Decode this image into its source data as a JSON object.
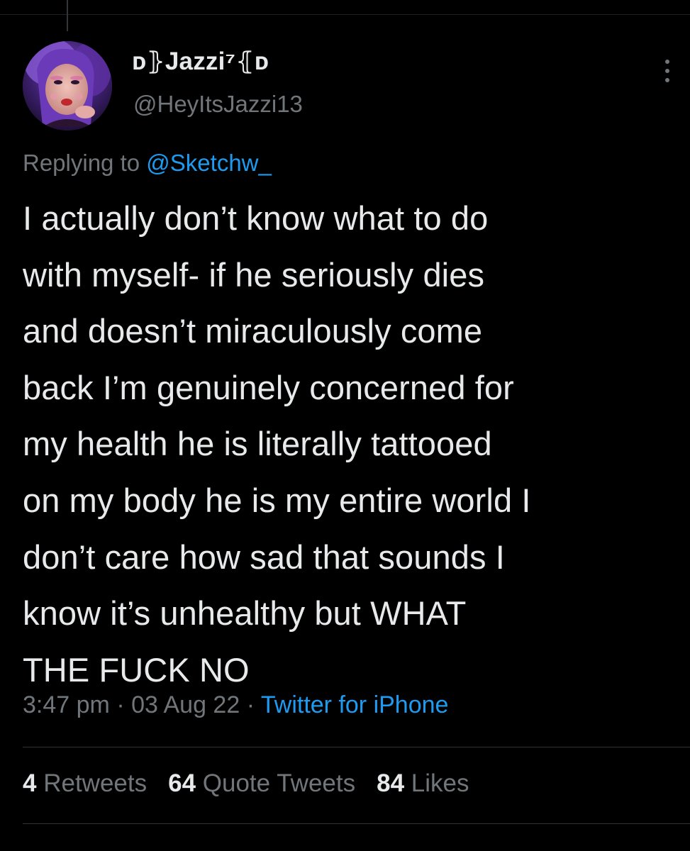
{
  "tweet": {
    "display_name": "ᴅ⦄Jazzi⁷⦃ᴅ",
    "handle": "@HeyItsJazzi13",
    "replying_prefix": "Replying to",
    "replying_to": "@Sketchw_",
    "text": "I actually don’t know what to do\nwith myself- if he seriously dies\nand doesn’t miraculously come\nback I’m genuinely concerned for\nmy health he is literally tattooed\non my body he is my entire world I\ndon’t care how sad that sounds I\nknow it’s unhealthy but WHAT\nTHE FUCK NO",
    "time": "3:47 pm",
    "date": "03 Aug 22",
    "source": "Twitter for iPhone",
    "separator": "·"
  },
  "stats": {
    "retweets_count": "4",
    "retweets_label": "Retweets",
    "quotes_count": "64",
    "quotes_label": "Quote Tweets",
    "likes_count": "84",
    "likes_label": "Likes"
  },
  "colors": {
    "background": "#000000",
    "primary_text": "#e7e9ea",
    "secondary_text": "#71767b",
    "accent": "#1d9bf0",
    "divider": "#2f3336"
  },
  "icons": {
    "more": "more-vertical-icon"
  }
}
